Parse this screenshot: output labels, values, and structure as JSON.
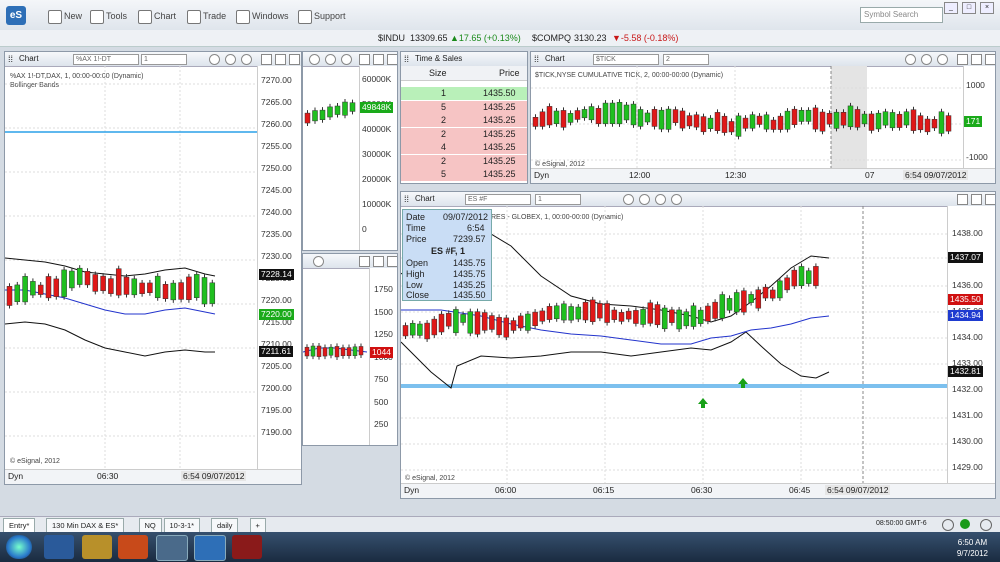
{
  "toolbar": {
    "logo": "eS",
    "new": "New",
    "tools": "Tools",
    "chart": "Chart",
    "trade": "Trade",
    "windows": "Windows",
    "support": "Support",
    "search_placeholder": "Symbol Search"
  },
  "ticker": {
    "indu_sym": "$INDU",
    "indu_val": "13309.65",
    "indu_chg": "▲17.65 (+0.13%)",
    "compq_sym": "$COMPQ",
    "compq_val": "3130.23",
    "compq_chg": "▼-5.58 (-0.18%)"
  },
  "dax": {
    "title": "Chart",
    "symbol": "%AX 1!-DT",
    "interval": "1",
    "study_line": "%AX 1!-DT,DAX, 1, 00:00-00:00 (Dynamic)",
    "study2": "Bollinger Bands",
    "axis": [
      "7270.00",
      "7265.00",
      "7260.00",
      "7255.00",
      "7250.00",
      "7245.00",
      "7240.00",
      "7235.00",
      "7230.00",
      "7225.00",
      "7220.00",
      "7215.00",
      "7210.00",
      "7205.00",
      "7200.00",
      "7195.00",
      "7190.00"
    ],
    "tag_upper": "7228.14",
    "tag_mid": "7220.00",
    "tag_lower": "7211.61",
    "copyright": "© eSignal, 2012",
    "time1": "06:30",
    "datetime": "6:54 09/07/2012",
    "dyn": "Dyn"
  },
  "vol": {
    "axis": [
      "60000K",
      "50000K",
      "40000K",
      "30000K",
      "20000K",
      "10000K",
      "0"
    ],
    "tag": "49848K"
  },
  "mini": {
    "axis": [
      "1750",
      "1500",
      "1250",
      "1000",
      "750",
      "500",
      "250"
    ],
    "tag": "1044"
  },
  "ts": {
    "title": "Time & Sales",
    "col_size": "Size",
    "col_price": "Price",
    "rows": [
      {
        "size": "1",
        "price": "1435.50"
      },
      {
        "size": "5",
        "price": "1435.25"
      },
      {
        "size": "2",
        "price": "1435.25"
      },
      {
        "size": "2",
        "price": "1435.25"
      },
      {
        "size": "4",
        "price": "1435.25"
      },
      {
        "size": "2",
        "price": "1435.25"
      },
      {
        "size": "5",
        "price": "1435.25"
      }
    ]
  },
  "tick": {
    "title": "Chart",
    "symbol": "$TICK",
    "interval": "2",
    "study_line": "$TICK,NYSE CUMULATIVE TICK, 2, 00:00-00:00 (Dynamic)",
    "axis": [
      "1000",
      "0",
      "-1000"
    ],
    "tag": "171",
    "copyright": "© eSignal, 2012",
    "t1": "12:00",
    "t2": "12:30",
    "t3": "07",
    "datetime": "6:54 09/07/2012",
    "dyn": "Dyn"
  },
  "es": {
    "title": "Chart",
    "symbol": "ES #F",
    "interval": "1",
    "study_line": "RES - GLOBEX, 1, 00:00-00:00 (Dynamic)",
    "axis": [
      "1438.00",
      "1437.00",
      "1436.00",
      "1435.00",
      "1434.00",
      "1433.00",
      "1432.00",
      "1431.00",
      "1430.00",
      "1429.00"
    ],
    "tag_upper": "1437.07",
    "tag_last": "1435.50",
    "tag_mid": "1434.94",
    "tag_lower": "1432.81",
    "copyright": "© eSignal, 2012",
    "t1": "06:00",
    "t2": "06:15",
    "t3": "06:30",
    "t4": "06:45",
    "datetime": "6:54 09/07/2012",
    "dyn": "Dyn"
  },
  "info": {
    "date_l": "Date",
    "date_v": "09/07/2012",
    "time_l": "Time",
    "time_v": "6:54",
    "price_l": "Price",
    "price_v": "7239.57",
    "sym": "ES #F, 1",
    "open_l": "Open",
    "open_v": "1435.75",
    "high_l": "High",
    "high_v": "1435.75",
    "low_l": "Low",
    "low_v": "1435.25",
    "close_l": "Close",
    "close_v": "1435.50"
  },
  "tabs": [
    "Entry*",
    "130 Min DAX & ES*",
    "NQ",
    "10-3-1*",
    "daily",
    "+"
  ],
  "status": {
    "time": "08:50:00 GMT-6"
  },
  "clock": {
    "time": "6:50 AM",
    "date": "9/7/2012"
  }
}
